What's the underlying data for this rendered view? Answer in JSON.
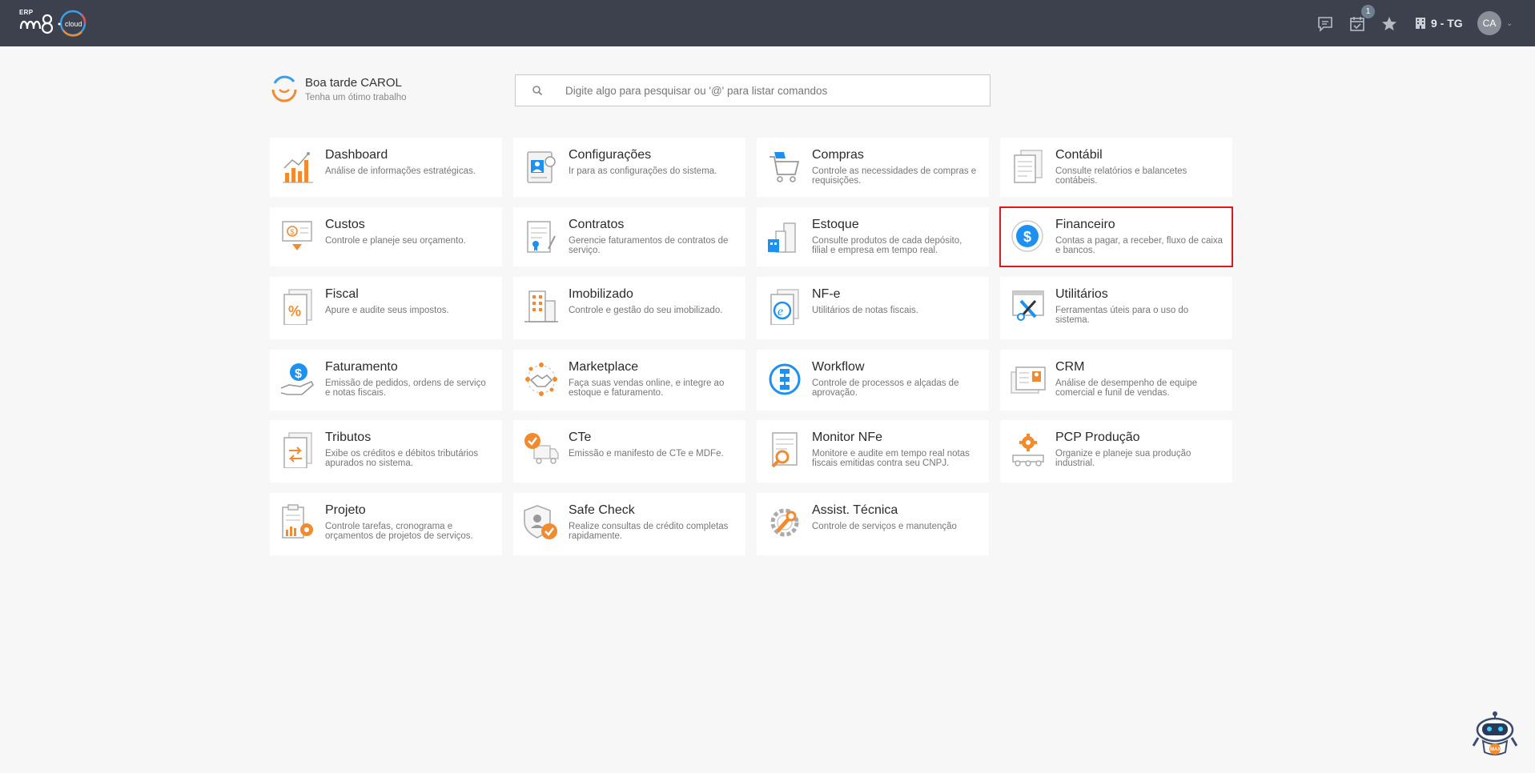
{
  "header": {
    "logo_erp": "ERP",
    "logo_cloud": "cloud",
    "notification_count": "1",
    "company": "9 - TG",
    "user_initials": "CA"
  },
  "greeting": {
    "title": "Boa tarde CAROL",
    "subtitle": "Tenha um ótimo trabalho"
  },
  "search": {
    "placeholder": "Digite algo para pesquisar ou '@' para listar comandos"
  },
  "modules": [
    {
      "title": "Dashboard",
      "desc": "Análise de informações estratégicas.",
      "icon": "bar-chart-icon"
    },
    {
      "title": "Configurações",
      "desc": "Ir para as configurações do sistema.",
      "icon": "settings-profile-icon"
    },
    {
      "title": "Compras",
      "desc": "Controle as necessidades de compras e requisições.",
      "icon": "shopping-cart-icon"
    },
    {
      "title": "Contábil",
      "desc": "Consulte relatórios e balancetes contábeis.",
      "icon": "ledger-icon"
    },
    {
      "title": "Custos",
      "desc": "Controle e planeje seu orçamento.",
      "icon": "cost-icon"
    },
    {
      "title": "Contratos",
      "desc": "Gerencie faturamentos de contratos de serviço.",
      "icon": "contract-icon"
    },
    {
      "title": "Estoque",
      "desc": "Consulte produtos de cada depósito, filial e empresa em tempo real.",
      "icon": "warehouse-icon"
    },
    {
      "title": "Financeiro",
      "desc": "Contas a pagar, a receber, fluxo de caixa e bancos.",
      "icon": "dollar-icon"
    },
    {
      "title": "Fiscal",
      "desc": "Apure e audite seus impostos.",
      "icon": "percent-document-icon"
    },
    {
      "title": "Imobilizado",
      "desc": "Controle e gestão do seu imobilizado.",
      "icon": "building-icon"
    },
    {
      "title": "NF-e",
      "desc": "Utilitários de notas fiscais.",
      "icon": "e-document-icon"
    },
    {
      "title": "Utilitários",
      "desc": "Ferramentas úteis para o uso do sistema.",
      "icon": "tools-icon"
    },
    {
      "title": "Faturamento",
      "desc": "Emissão de pedidos, ordens de serviço e notas fiscais.",
      "icon": "hand-dollar-icon"
    },
    {
      "title": "Marketplace",
      "desc": "Faça suas vendas online, e integre ao estoque e faturamento.",
      "icon": "handshake-icon"
    },
    {
      "title": "Workflow",
      "desc": "Controle de processos e alçadas de aprovação.",
      "icon": "workflow-icon"
    },
    {
      "title": "CRM",
      "desc": "Análise de desempenho de equipe comercial e funil de vendas.",
      "icon": "crm-card-icon"
    },
    {
      "title": "Tributos",
      "desc": "Exibe os créditos e débitos tributários apurados no sistema.",
      "icon": "exchange-document-icon"
    },
    {
      "title": "CTe",
      "desc": "Emissão e manifesto de CTe e MDFe.",
      "icon": "truck-check-icon"
    },
    {
      "title": "Monitor NFe",
      "desc": "Monitore e audite em tempo real notas fiscais emitidas contra seu CNPJ.",
      "icon": "document-search-icon"
    },
    {
      "title": "PCP Produção",
      "desc": "Organize e planeje sua produção industrial.",
      "icon": "production-gear-icon"
    },
    {
      "title": "Projeto",
      "desc": "Controle tarefas, cronograma e orçamentos de projetos de serviços.",
      "icon": "clipboard-gear-icon"
    },
    {
      "title": "Safe Check",
      "desc": "Realize consultas de crédito completas rapidamente.",
      "icon": "shield-check-icon"
    },
    {
      "title": "Assist. Técnica",
      "desc": "Controle de serviços e manutenção",
      "icon": "wrench-gear-icon"
    }
  ],
  "selected_module": "Financeiro",
  "assistant": {
    "label": "MAX"
  },
  "colors": {
    "topbar": "#3d414d",
    "accent_orange": "#f08b2f",
    "accent_blue": "#1e90f0",
    "selection": "#e0161b"
  }
}
